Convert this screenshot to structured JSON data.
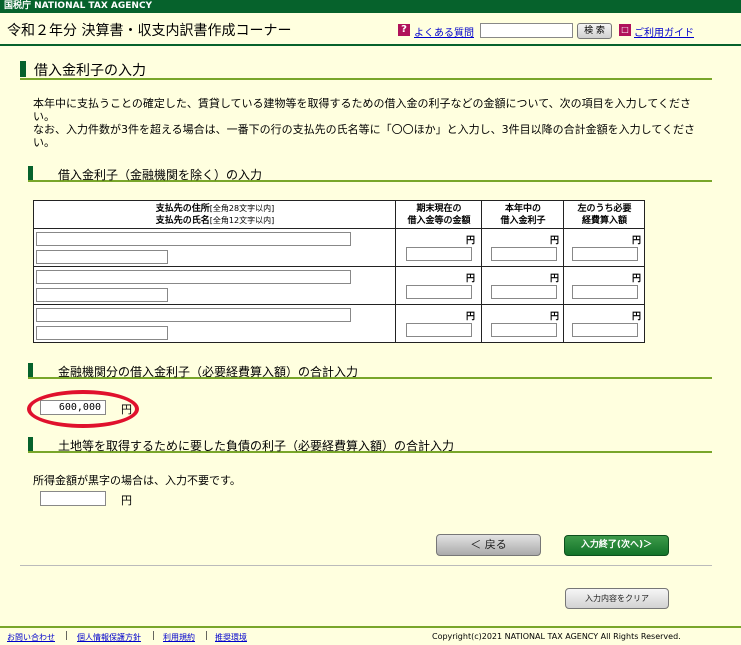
{
  "agency_bar": {
    "text": "国税庁  NATIONAL TAX AGENCY"
  },
  "header": {
    "title": "令和２年分 決算書・収支内訳書作成コーナー",
    "faq_icon": "?",
    "faq_link": "よくある質問",
    "search_button": "検 索",
    "guide_icon": "□",
    "guide_link": "ご利用ガイド"
  },
  "page": {
    "title": "借入金利子の入力",
    "intro_line1": "本年中に支払うことの確定した、賃貸している建物等を取得するための借入金の利子などの金額について、次の項目を入力してください。",
    "intro_line2": "なお、入力件数が3件を超える場合は、一番下の行の支払先の氏名等に「〇〇ほか」と入力し、3件目以降の合計金額を入力してください。"
  },
  "section1": {
    "title": "借入金利子（金融機関を除く）の入力",
    "col_address": "支払先の住所",
    "col_address_hint": "[全角28文字以内]",
    "col_name": "支払先の氏名",
    "col_name_hint": "[全角12文字以内]",
    "col_balance_1": "期末現在の",
    "col_balance_2": "借入金等の金額",
    "col_interest_1": "本年中の",
    "col_interest_2": "借入金利子",
    "col_expense_1": "左のうち必要",
    "col_expense_2": "経費算入額",
    "yen": "円"
  },
  "section2": {
    "title": "金融機関分の借入金利子（必要経費算入額）の合計入力",
    "value": "600,000",
    "yen": "円"
  },
  "section3": {
    "title": "土地等を取得するために要した負債の利子（必要経費算入額）の合計入力",
    "note": "所得金額が黒字の場合は、入力不要です。",
    "value": "",
    "yen": "円"
  },
  "actions": {
    "back": "＜ 戻る",
    "finish": "入力終了(次へ)＞",
    "clear": "入力内容をクリア"
  },
  "footer": {
    "contact": "お問い合わせ",
    "privacy": "個人情報保護方針",
    "terms": "利用規約",
    "env": "推奨環境",
    "separator": "|",
    "copyright": "Copyright(c)2021 NATIONAL TAX AGENCY All Rights Reserved."
  },
  "colors": {
    "brand_green": "#06622c",
    "accent_green": "#79a62a",
    "background": "#ffffdf",
    "highlight_red": "#e0112d"
  }
}
